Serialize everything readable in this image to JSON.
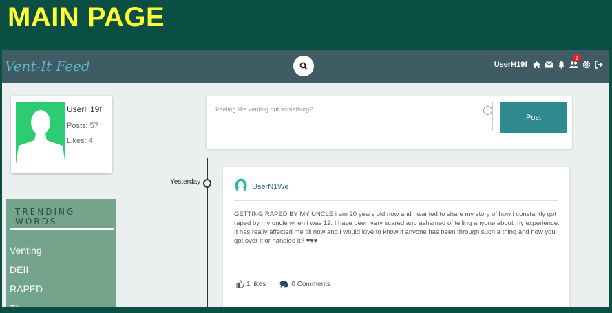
{
  "slide": {
    "title": "MAIN PAGE"
  },
  "navbar": {
    "brand": "Vent-It Feed",
    "username": "UserH19f",
    "notification_count": "1",
    "icons": [
      "search-icon",
      "home-icon",
      "envelope-icon",
      "bell-icon",
      "users-icon",
      "gear-icon",
      "logout-icon"
    ]
  },
  "profile": {
    "username": "UserH19f",
    "posts": "Posts: 57",
    "likes": "Likes: 4"
  },
  "trending": {
    "title": "TRENDING WORDS",
    "items": [
      "Venting",
      "DEII",
      "RAPED",
      "Th"
    ]
  },
  "composer": {
    "placeholder": "Feeling like venting out something?",
    "post_label": "Post"
  },
  "timeline": {
    "label": "Yesterday"
  },
  "post": {
    "username": "UserN1We",
    "text": "GETTING RAPED BY MY UNCLE i am 20 years old now and i wanted to share my story of how i constantly got raped by my uncle when i was 12. I have been very scared and ashamed of telling anyone about my experience. It has really affected me till now and i would love to know if anyone has been through such a thing and how you got over it or handled it? ♥♥♥",
    "likes": "1 likes",
    "comments": "0 Comments"
  },
  "colors": {
    "background": "#0b4e43",
    "title": "#ffff33",
    "navbar": "#3f5c65",
    "accent": "#2f8a90",
    "avatar": "#2ecc71",
    "trending": "#74a58c"
  }
}
